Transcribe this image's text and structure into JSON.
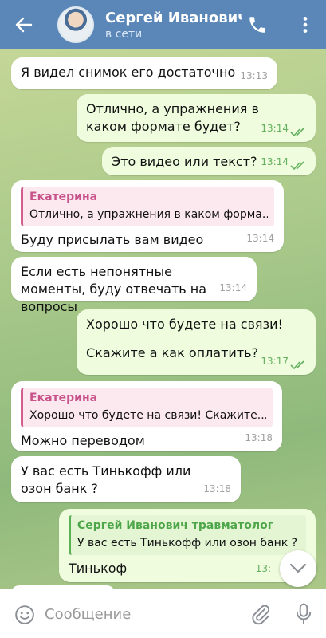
{
  "header": {
    "name": "Сергей Иванович травматолог",
    "status": "в сети"
  },
  "messages": [
    {
      "dir": "in",
      "text": "Я видел снимок его достаточно",
      "time": "13:13"
    },
    {
      "dir": "out",
      "text": "Отлично, а упражнения в каком формате будет?",
      "time": "13:14"
    },
    {
      "dir": "out",
      "text": "Это видео или текст?",
      "time": "13:14"
    },
    {
      "dir": "in",
      "reply_name": "Екатерина",
      "reply_text": "Отлично, а упражнения в каком форма...",
      "text": "Буду присылать вам видео",
      "time": "13:14"
    },
    {
      "dir": "in",
      "text": "Если есть непонятные моменты, буду отвечать на вопросы",
      "time": "13:14"
    },
    {
      "dir": "out",
      "text": "Хорошо что будете на связи!",
      "text2": "Скажите а как оплатить?",
      "time": "13:17"
    },
    {
      "dir": "in",
      "reply_name": "Екатерина",
      "reply_text": "Хорошо что будете на связи!  Скажите...",
      "text": "Можно переводом",
      "time": "13:18"
    },
    {
      "dir": "in",
      "text": "У вас есть Тинькофф или озон банк ?",
      "time": "13:18"
    },
    {
      "dir": "out",
      "reply_name": "Сергей Иванович травматолог",
      "reply_text": "У вас есть Тинькофф или озон банк ?",
      "text": "Тинькоф",
      "time": "13:"
    }
  ],
  "input": {
    "placeholder": "Сообщение"
  },
  "icons": {
    "back": "arrow-left-icon",
    "call": "phone-icon",
    "more": "more-vert-icon",
    "emoji": "emoji-icon",
    "attach": "paperclip-icon",
    "mic": "microphone-icon",
    "scroll": "chevron-down-icon"
  },
  "colors": {
    "header": "#5a87b8",
    "incoming": "#ffffff",
    "outgoing": "#effdde",
    "reply_accent": "#d15e8e"
  }
}
